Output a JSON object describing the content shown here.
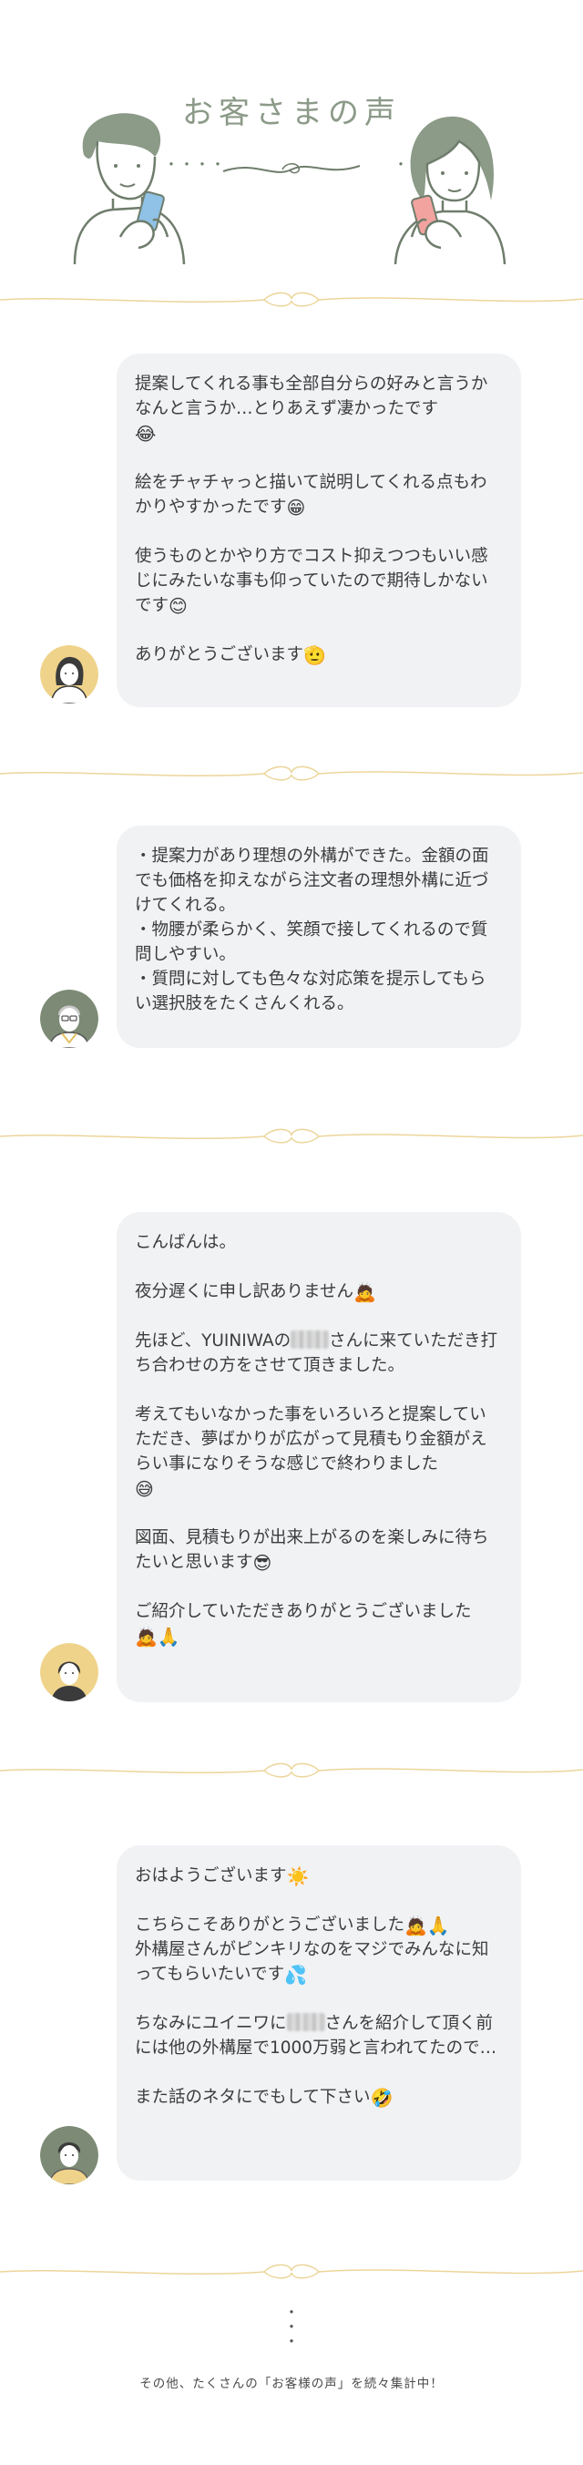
{
  "header": {
    "title": "お客さまの声",
    "dots": "・・・・"
  },
  "reviews": [
    {
      "avatar": "woman-avatar",
      "avatar_bg": "#efd38a",
      "paragraphs": [
        {
          "text": "提案してくれる事も全部自分らの好みと言うかなんと言うか…とりあえず凄かったです",
          "emoji": "😂"
        },
        {
          "text": "絵をチャチャっと描いて説明してくれる点もわかりやすかったです",
          "emoji": "😁"
        },
        {
          "text": "使うものとかやり方でコスト抑えつつもいい感じにみたいな事も仰っていたので期待しかないです",
          "emoji": "😊"
        },
        {
          "text": "ありがとうございます",
          "emoji": "🫡"
        }
      ]
    },
    {
      "avatar": "older-man-avatar",
      "avatar_bg": "#7c8a76",
      "paragraphs": [
        {
          "text": "・提案力があり理想の外構ができた。金額の面でも価格を抑えながら注文者の理想外構に近づけてくれる。\n・物腰が柔らかく、笑顔で接してくれるので質問しやすい。\n・質問に対しても色々な対応策を提示してもらい選択肢をたくさんくれる。",
          "emoji": ""
        }
      ]
    },
    {
      "avatar": "young-woman-avatar",
      "avatar_bg": "#efd38a",
      "paragraphs": [
        {
          "text": "こんばんは。",
          "emoji": ""
        },
        {
          "text": "夜分遅くに申し訳ありません",
          "emoji": "🙇"
        },
        {
          "text_before": "先ほど、YUINIWAの",
          "text_after": "さんに来ていただき打ち合わせの方をさせて頂きました。",
          "redacted": true
        },
        {
          "text": "考えてもいなかった事をいろいろと提案していただき、夢ばかりが広がって見積もり金額がえらい事になりそうな感じで終わりました",
          "emoji": "😅"
        },
        {
          "text": "図面、見積もりが出来上がるのを楽しみに待ちたいと思います",
          "emoji": "😎"
        },
        {
          "text": "ご紹介していただきありがとうございました",
          "emoji": "🙇🙏"
        }
      ]
    },
    {
      "avatar": "young-man-avatar",
      "avatar_bg": "#7c8a76",
      "paragraphs": [
        {
          "text": "おはようございます",
          "emoji": "☀️"
        },
        {
          "text": "こちらこそありがとうございました",
          "emoji": "🙇🙏",
          "tight": true
        },
        {
          "text": "外構屋さんがピンキリなのをマジでみんなに知ってもらいたいです",
          "emoji": "💦"
        },
        {
          "text_before": "ちなみにユイニワに",
          "text_after": "さんを紹介して頂く前には他の外構屋で1000万弱と言われてたので…",
          "redacted": true
        },
        {
          "text": "また話のネタにでもして下さい",
          "emoji": "🤣"
        }
      ]
    }
  ],
  "footer": {
    "more": "・\n・\n・",
    "note": "その他、たくさんの「お客様の声」を続々集計中！"
  },
  "colors": {
    "title": "#8c9a88",
    "bubble": "#f1f2f4",
    "divider": "#ecd59a",
    "illustration": "#6f7d6c"
  }
}
